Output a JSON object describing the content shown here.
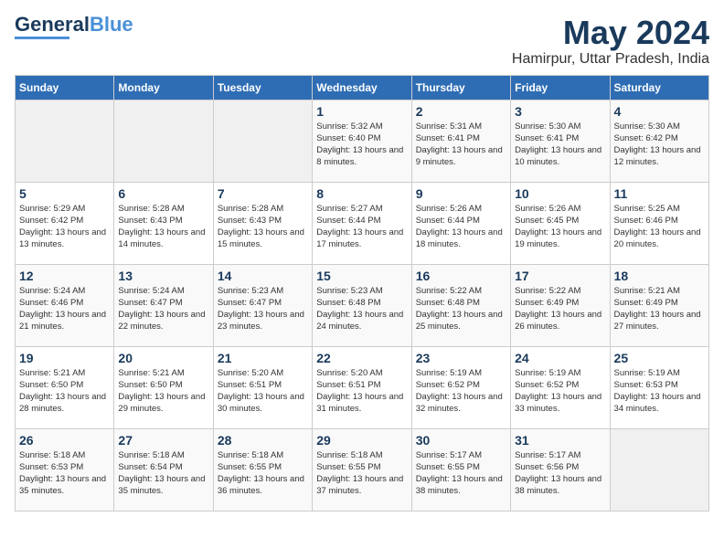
{
  "logo": {
    "line1": "General",
    "line2": "Blue"
  },
  "title": "May 2024",
  "location": "Hamirpur, Uttar Pradesh, India",
  "days_of_week": [
    "Sunday",
    "Monday",
    "Tuesday",
    "Wednesday",
    "Thursday",
    "Friday",
    "Saturday"
  ],
  "weeks": [
    [
      {
        "day": "",
        "info": ""
      },
      {
        "day": "",
        "info": ""
      },
      {
        "day": "",
        "info": ""
      },
      {
        "day": "1",
        "info": "Sunrise: 5:32 AM\nSunset: 6:40 PM\nDaylight: 13 hours\nand 8 minutes."
      },
      {
        "day": "2",
        "info": "Sunrise: 5:31 AM\nSunset: 6:41 PM\nDaylight: 13 hours\nand 9 minutes."
      },
      {
        "day": "3",
        "info": "Sunrise: 5:30 AM\nSunset: 6:41 PM\nDaylight: 13 hours\nand 10 minutes."
      },
      {
        "day": "4",
        "info": "Sunrise: 5:30 AM\nSunset: 6:42 PM\nDaylight: 13 hours\nand 12 minutes."
      }
    ],
    [
      {
        "day": "5",
        "info": "Sunrise: 5:29 AM\nSunset: 6:42 PM\nDaylight: 13 hours\nand 13 minutes."
      },
      {
        "day": "6",
        "info": "Sunrise: 5:28 AM\nSunset: 6:43 PM\nDaylight: 13 hours\nand 14 minutes."
      },
      {
        "day": "7",
        "info": "Sunrise: 5:28 AM\nSunset: 6:43 PM\nDaylight: 13 hours\nand 15 minutes."
      },
      {
        "day": "8",
        "info": "Sunrise: 5:27 AM\nSunset: 6:44 PM\nDaylight: 13 hours\nand 17 minutes."
      },
      {
        "day": "9",
        "info": "Sunrise: 5:26 AM\nSunset: 6:44 PM\nDaylight: 13 hours\nand 18 minutes."
      },
      {
        "day": "10",
        "info": "Sunrise: 5:26 AM\nSunset: 6:45 PM\nDaylight: 13 hours\nand 19 minutes."
      },
      {
        "day": "11",
        "info": "Sunrise: 5:25 AM\nSunset: 6:46 PM\nDaylight: 13 hours\nand 20 minutes."
      }
    ],
    [
      {
        "day": "12",
        "info": "Sunrise: 5:24 AM\nSunset: 6:46 PM\nDaylight: 13 hours\nand 21 minutes."
      },
      {
        "day": "13",
        "info": "Sunrise: 5:24 AM\nSunset: 6:47 PM\nDaylight: 13 hours\nand 22 minutes."
      },
      {
        "day": "14",
        "info": "Sunrise: 5:23 AM\nSunset: 6:47 PM\nDaylight: 13 hours\nand 23 minutes."
      },
      {
        "day": "15",
        "info": "Sunrise: 5:23 AM\nSunset: 6:48 PM\nDaylight: 13 hours\nand 24 minutes."
      },
      {
        "day": "16",
        "info": "Sunrise: 5:22 AM\nSunset: 6:48 PM\nDaylight: 13 hours\nand 25 minutes."
      },
      {
        "day": "17",
        "info": "Sunrise: 5:22 AM\nSunset: 6:49 PM\nDaylight: 13 hours\nand 26 minutes."
      },
      {
        "day": "18",
        "info": "Sunrise: 5:21 AM\nSunset: 6:49 PM\nDaylight: 13 hours\nand 27 minutes."
      }
    ],
    [
      {
        "day": "19",
        "info": "Sunrise: 5:21 AM\nSunset: 6:50 PM\nDaylight: 13 hours\nand 28 minutes."
      },
      {
        "day": "20",
        "info": "Sunrise: 5:21 AM\nSunset: 6:50 PM\nDaylight: 13 hours\nand 29 minutes."
      },
      {
        "day": "21",
        "info": "Sunrise: 5:20 AM\nSunset: 6:51 PM\nDaylight: 13 hours\nand 30 minutes."
      },
      {
        "day": "22",
        "info": "Sunrise: 5:20 AM\nSunset: 6:51 PM\nDaylight: 13 hours\nand 31 minutes."
      },
      {
        "day": "23",
        "info": "Sunrise: 5:19 AM\nSunset: 6:52 PM\nDaylight: 13 hours\nand 32 minutes."
      },
      {
        "day": "24",
        "info": "Sunrise: 5:19 AM\nSunset: 6:52 PM\nDaylight: 13 hours\nand 33 minutes."
      },
      {
        "day": "25",
        "info": "Sunrise: 5:19 AM\nSunset: 6:53 PM\nDaylight: 13 hours\nand 34 minutes."
      }
    ],
    [
      {
        "day": "26",
        "info": "Sunrise: 5:18 AM\nSunset: 6:53 PM\nDaylight: 13 hours\nand 35 minutes."
      },
      {
        "day": "27",
        "info": "Sunrise: 5:18 AM\nSunset: 6:54 PM\nDaylight: 13 hours\nand 35 minutes."
      },
      {
        "day": "28",
        "info": "Sunrise: 5:18 AM\nSunset: 6:55 PM\nDaylight: 13 hours\nand 36 minutes."
      },
      {
        "day": "29",
        "info": "Sunrise: 5:18 AM\nSunset: 6:55 PM\nDaylight: 13 hours\nand 37 minutes."
      },
      {
        "day": "30",
        "info": "Sunrise: 5:17 AM\nSunset: 6:55 PM\nDaylight: 13 hours\nand 38 minutes."
      },
      {
        "day": "31",
        "info": "Sunrise: 5:17 AM\nSunset: 6:56 PM\nDaylight: 13 hours\nand 38 minutes."
      },
      {
        "day": "",
        "info": ""
      }
    ]
  ]
}
